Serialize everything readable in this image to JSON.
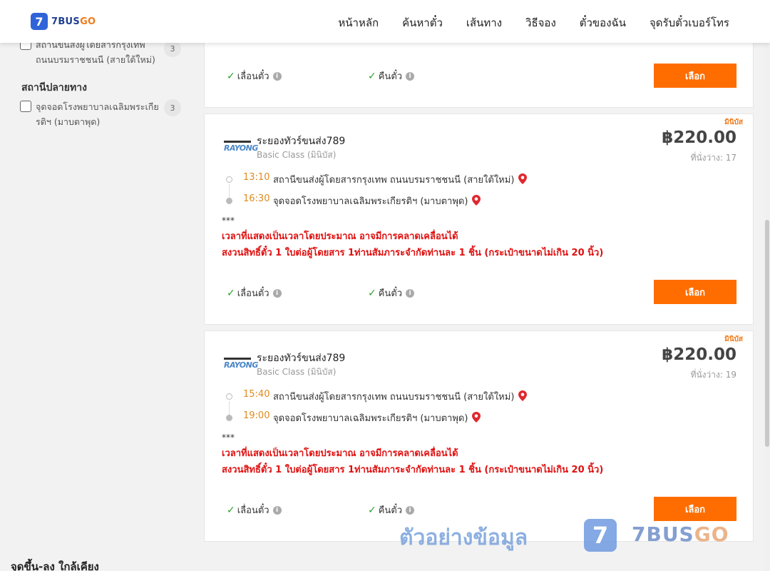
{
  "brand": {
    "mark": "7",
    "name_main": "7BUS",
    "name_accent": "GO"
  },
  "nav": [
    "หน้าหลัก",
    "ค้นหาตั๋ว",
    "เส้นทาง",
    "วิธีจอง",
    "ตั๋วของฉัน",
    "จุดรับตั๋วเบอร์โทร"
  ],
  "sidebar": {
    "departure_items": [
      {
        "label": "สถานีขนส่งผู้โดยสารกรุงเทพ ถนนบรมราชชนนี (สายใต้ใหม่)",
        "count": "3"
      }
    ],
    "arrival_title": "สถานีปลายทาง",
    "arrival_items": [
      {
        "label": "จุดจอดโรงพยาบาลเฉลิมพระเกียรติฯ (มาบตาพุด)",
        "count": "3"
      }
    ],
    "nearby_title": "จุดขึ้น-ลง ใกล้เคียง"
  },
  "feature_labels": {
    "change": "เลื่อนตั๋ว",
    "refund": "คืนตั๋ว",
    "select": "เลือก"
  },
  "trips": [
    {
      "promo": "มินิบัส",
      "operator_logo": "RAYONG",
      "operator": "ระยองทัวร์ขนส่ง789",
      "class": "Basic Class (มินิบัส)",
      "price": "฿220.00",
      "seats": "ที่นั่งว่าง: 17",
      "dep_time": "13:10",
      "dep_station": "สถานีขนส่งผู้โดยสารกรุงเทพ ถนนบรมราชชนนี (สายใต้ใหม่)",
      "arr_time": "16:30",
      "arr_station": "จุดจอดโรงพยาบาลเฉลิมพระเกียรติฯ (มาบตาพุด)",
      "note_stars": "***",
      "note1": "เวลาที่แสดงเป็นเวลาโดยประมาณ อาจมีการคลาดเคลื่อนได้",
      "note2": "สงวนสิทธิ์ตั๋ว 1 ใบต่อผู้โดยสาร 1ท่านสัมภาระจำกัดท่านละ 1 ชิ้น (กระเป๋าขนาดไม่เกิน 20 นิ้ว)"
    },
    {
      "promo": "มินิบัส",
      "operator_logo": "RAYONG",
      "operator": "ระยองทัวร์ขนส่ง789",
      "class": "Basic Class (มินิบัส)",
      "price": "฿220.00",
      "seats": "ที่นั่งว่าง: 19",
      "dep_time": "15:40",
      "dep_station": "สถานีขนส่งผู้โดยสารกรุงเทพ ถนนบรมราชชนนี (สายใต้ใหม่)",
      "arr_time": "19:00",
      "arr_station": "จุดจอดโรงพยาบาลเฉลิมพระเกียรติฯ (มาบตาพุด)",
      "note_stars": "***",
      "note1": "เวลาที่แสดงเป็นเวลาโดยประมาณ อาจมีการคลาดเคลื่อนได้",
      "note2": "สงวนสิทธิ์ตั๋ว 1 ใบต่อผู้โดยสาร 1ท่านสัมภาระจำกัดท่านละ 1 ชิ้น (กระเป๋าขนาดไม่เกิน 20 นิ้ว)"
    }
  ],
  "watermark": {
    "text": "ตัวอย่างข้อมูล",
    "mark": "7",
    "brand_main": "7BUS",
    "brand_accent": "GO"
  },
  "colors": {
    "accent": "#ff6d00",
    "brand_blue": "#2f63d8",
    "warning_red": "#e01010",
    "time_orange": "#e08a1e"
  }
}
